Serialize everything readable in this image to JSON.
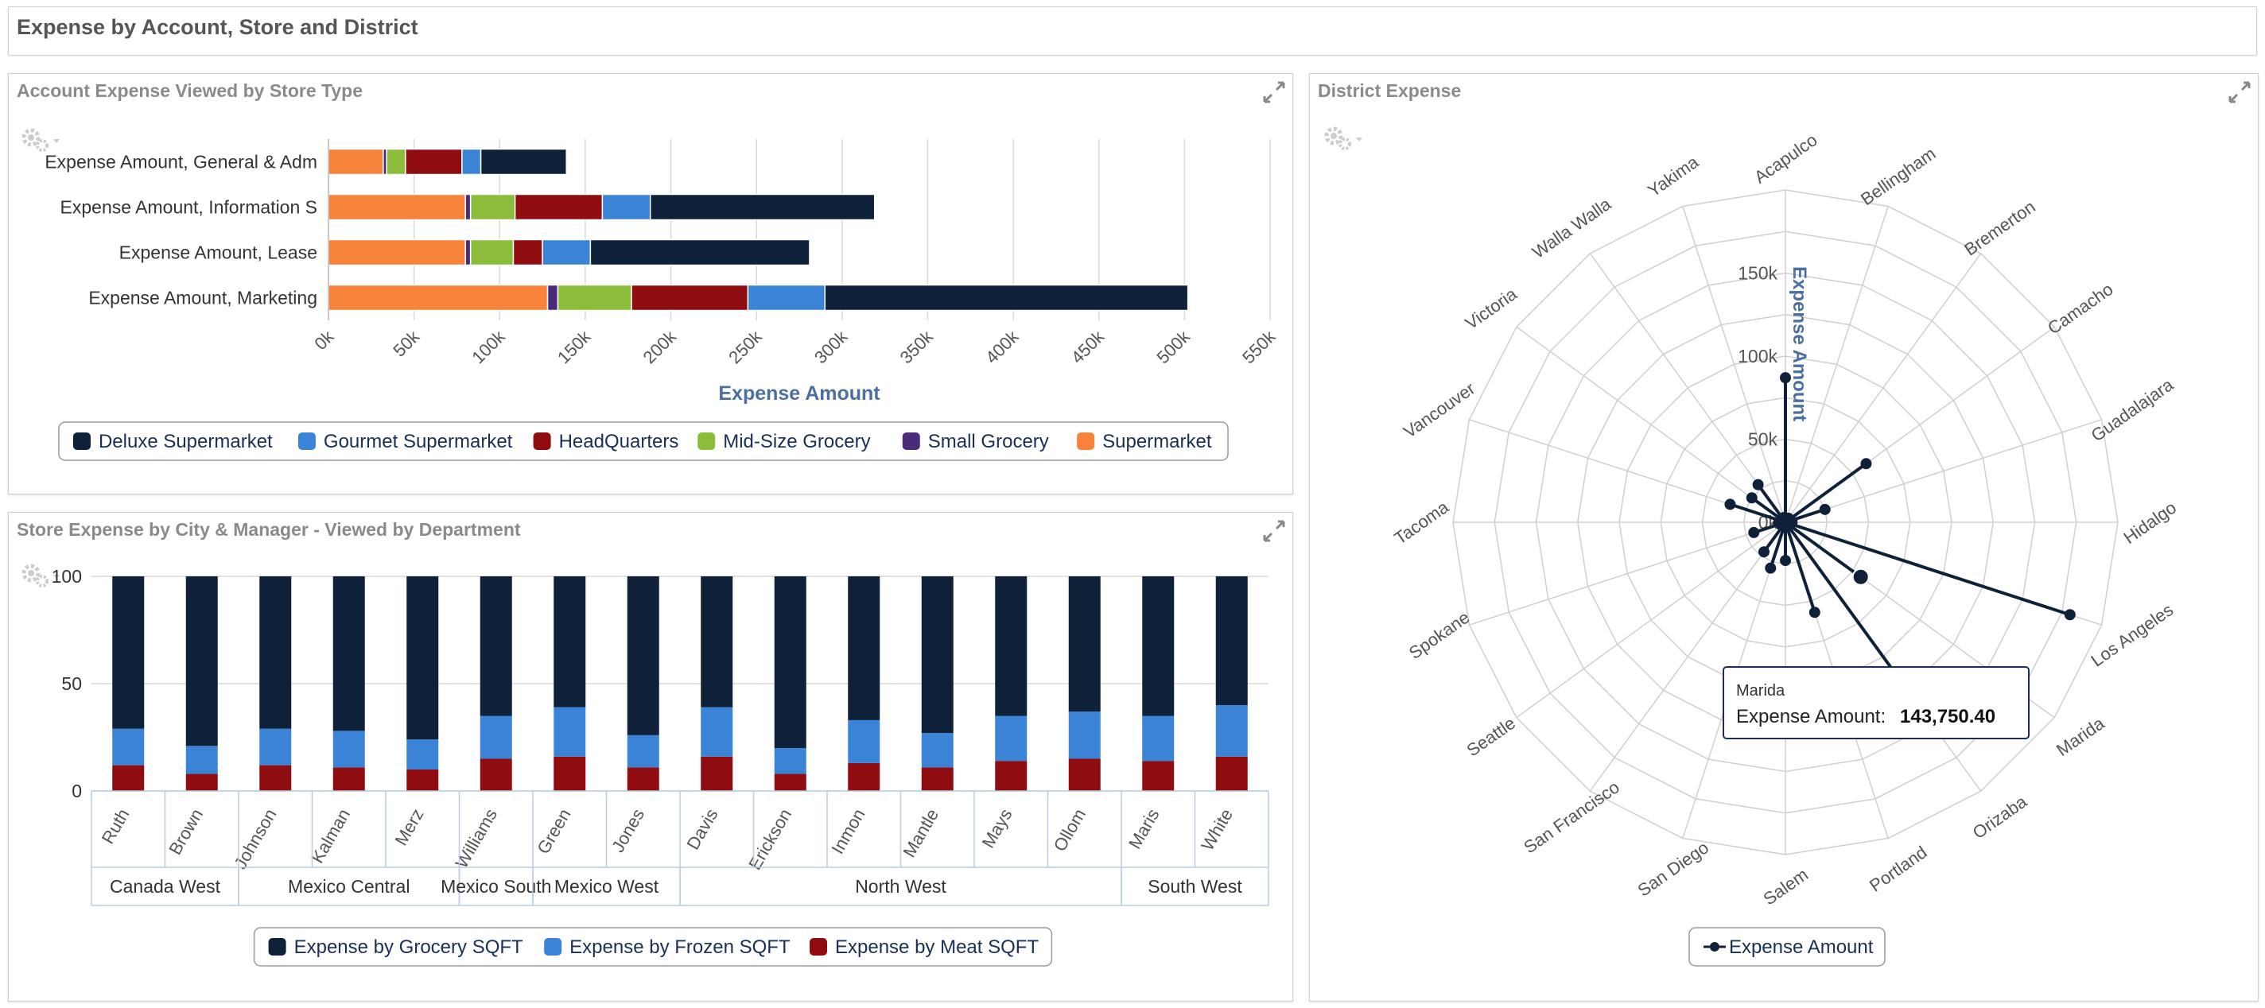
{
  "page": {
    "title": "Expense by Account, Store and District"
  },
  "panels": {
    "account": {
      "title": "Account Expense Viewed by Store Type"
    },
    "store": {
      "title": "Store Expense by City & Manager - Viewed by Department"
    },
    "district": {
      "title": "District Expense"
    }
  },
  "colors": {
    "deluxe": "#0f2138",
    "gourmet": "#3a83d6",
    "hq": "#8f0d10",
    "midsize": "#8cbd3a",
    "small": "#4b2a7c",
    "supermarket": "#f7823a",
    "axis_title": "#4a6fa0"
  },
  "chart_data": [
    {
      "type": "bar",
      "orientation": "horizontal",
      "stacked": true,
      "categories": [
        "Expense Amount, General & Adm",
        "Expense Amount, Information S",
        "Expense Amount, Lease",
        "Expense Amount, Marketing"
      ],
      "series": [
        {
          "name": "Supermarket",
          "color": "supermarket",
          "values": [
            32000,
            80000,
            80000,
            128000
          ]
        },
        {
          "name": "Small Grocery",
          "color": "small",
          "values": [
            2000,
            3000,
            3000,
            6000
          ]
        },
        {
          "name": "Mid-Size Grocery",
          "color": "midsize",
          "values": [
            11000,
            26000,
            25000,
            43000
          ]
        },
        {
          "name": "HeadQuarters",
          "color": "hq",
          "values": [
            33000,
            51000,
            17000,
            68000
          ]
        },
        {
          "name": "Gourmet Supermarket",
          "color": "gourmet",
          "values": [
            11000,
            28000,
            28000,
            45000
          ]
        },
        {
          "name": "Deluxe Supermarket",
          "color": "deluxe",
          "values": [
            50000,
            131000,
            128000,
            212000
          ]
        }
      ],
      "xlim": [
        0,
        550000
      ],
      "xticks": [
        "0k",
        "50k",
        "100k",
        "150k",
        "200k",
        "250k",
        "300k",
        "350k",
        "400k",
        "450k",
        "500k",
        "550k"
      ],
      "xlabel": "Expense Amount",
      "legend": [
        {
          "name": "Deluxe Supermarket",
          "color": "deluxe"
        },
        {
          "name": "Gourmet Supermarket",
          "color": "gourmet"
        },
        {
          "name": "HeadQuarters",
          "color": "hq"
        },
        {
          "name": "Mid-Size Grocery",
          "color": "midsize"
        },
        {
          "name": "Small Grocery",
          "color": "small"
        },
        {
          "name": "Supermarket",
          "color": "supermarket"
        }
      ],
      "grid": true,
      "legend_position": "bottom"
    },
    {
      "type": "bar",
      "stacked": true,
      "percent": true,
      "categories": [
        "Ruth",
        "Brown",
        "Johnson",
        "Kalman",
        "Merz",
        "Williams",
        "Green",
        "Jones",
        "Davis",
        "Erickson",
        "Inmon",
        "Mantle",
        "Mays",
        "Ollom",
        "Maris",
        "White"
      ],
      "groups": [
        {
          "label": "Canada West",
          "count": 2
        },
        {
          "label": "Mexico Central",
          "count": 3
        },
        {
          "label": "Mexico South",
          "count": 1
        },
        {
          "label": "Mexico West",
          "count": 2
        },
        {
          "label": "North West",
          "count": 6
        },
        {
          "label": "South West",
          "count": 2
        }
      ],
      "series": [
        {
          "name": "Expense by Meat SQFT",
          "color": "hq",
          "values": [
            12,
            8,
            12,
            11,
            10,
            15,
            16,
            11,
            16,
            8,
            13,
            11,
            14,
            15,
            14,
            16
          ]
        },
        {
          "name": "Expense by Frozen SQFT",
          "color": "gourmet",
          "values": [
            17,
            13,
            17,
            17,
            14,
            20,
            23,
            15,
            23,
            12,
            20,
            16,
            21,
            22,
            21,
            24
          ]
        },
        {
          "name": "Expense by Grocery SQFT",
          "color": "deluxe",
          "values": [
            71,
            79,
            71,
            72,
            76,
            65,
            61,
            74,
            61,
            80,
            67,
            73,
            65,
            63,
            65,
            60
          ]
        }
      ],
      "ylim": [
        0,
        100
      ],
      "yticks": [
        "0",
        "50",
        "100"
      ],
      "legend": [
        {
          "name": "Expense by Grocery SQFT",
          "color": "deluxe"
        },
        {
          "name": "Expense by Frozen SQFT",
          "color": "gourmet"
        },
        {
          "name": "Expense by Meat SQFT",
          "color": "hq"
        }
      ],
      "grid": true,
      "legend_position": "bottom"
    },
    {
      "type": "radar",
      "categories": [
        "Acapulco",
        "Bellingham",
        "Bremerton",
        "Camacho",
        "Guadalajara",
        "Hidalgo",
        "Los Angeles",
        "Marida",
        "Orizaba",
        "Portland",
        "Salem",
        "San Diego",
        "San Francisco",
        "Seattle",
        "Spokane",
        "Tacoma",
        "Vancouver",
        "Victoria",
        "Walla Walla",
        "Yakima"
      ],
      "series": [
        {
          "name": "Expense Amount",
          "color": "deluxe",
          "values": [
            87000,
            2000,
            3000,
            60000,
            25000,
            4000,
            180000,
            56000,
            143750.4,
            57000,
            23000,
            29000,
            22000,
            3000,
            20000,
            4000,
            35000,
            25000,
            28000,
            3000
          ]
        }
      ],
      "rlim": [
        0,
        200000
      ],
      "rticks": [
        "0k",
        "50k",
        "100k",
        "150k"
      ],
      "axis_title": "Expense Amount",
      "legend": [
        {
          "name": "Expense Amount",
          "color": "deluxe"
        }
      ],
      "legend_position": "bottom",
      "tooltip": {
        "title": "Marida",
        "label": "Expense Amount:",
        "value": "143,750.40"
      }
    }
  ]
}
